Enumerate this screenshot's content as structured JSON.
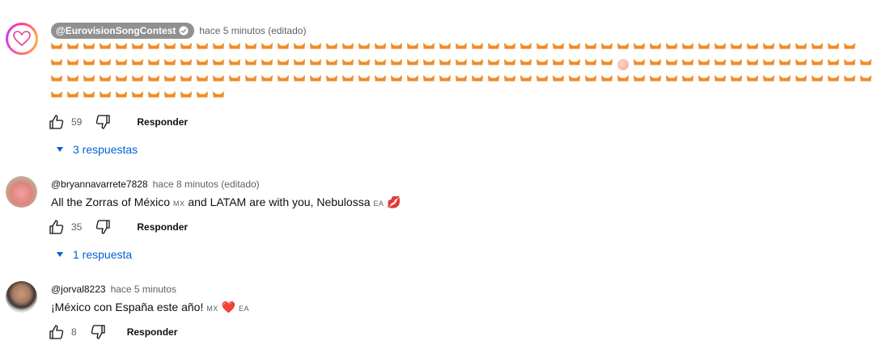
{
  "comments": [
    {
      "author": "@EurovisionSongContest",
      "time": "hace 5 minutos (editado)",
      "likes": "59",
      "reply_label": "Responder",
      "replies": "3 respuestas",
      "emoji_rows": [
        {
          "foxes_before_peach": 50,
          "has_peach": false,
          "foxes_after_peach": 0
        },
        {
          "foxes_before_peach": 35,
          "has_peach": true,
          "foxes_after_peach": 15
        },
        {
          "foxes_before_peach": 51,
          "has_peach": false,
          "foxes_after_peach": 0
        },
        {
          "foxes_before_peach": 11,
          "has_peach": false,
          "foxes_after_peach": 0
        }
      ]
    },
    {
      "author": "@bryannavarrete7828",
      "time": "hace 8 minutos (editado)",
      "text_main": "All the Zorras of México",
      "text_tag1": "MX",
      "text_mid": "and LATAM are with you, Nebulossa",
      "text_tag2": "EA",
      "likes": "35",
      "reply_label": "Responder",
      "replies": "1 respuesta"
    },
    {
      "author": "@jorval8223",
      "time": "hace 5 minutos",
      "text_main": "¡México con España este año!",
      "text_tag1": "MX",
      "text_tag2": "EA",
      "likes": "8",
      "reply_label": "Responder"
    }
  ],
  "colors": {
    "link": "#065fd4",
    "meta": "#606060",
    "text": "#0f0f0f",
    "pill": "#909090"
  }
}
